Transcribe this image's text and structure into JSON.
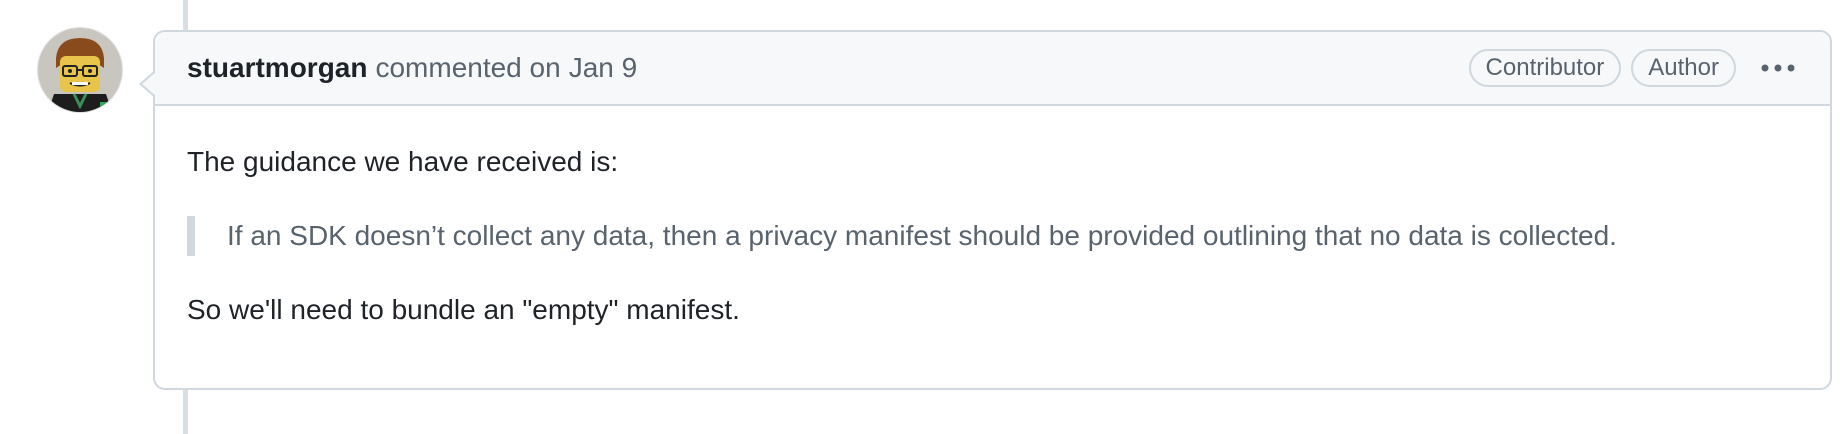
{
  "timeline": {
    "comment": {
      "author": "stuartmorgan",
      "action_text": "commented on",
      "date": "Jan 9",
      "badges": [
        "Contributor",
        "Author"
      ],
      "more_options_icon": "kebab-horizontal-icon",
      "body": {
        "paragraph_1": "The guidance we have received is:",
        "quote": "If an SDK doesn’t collect any data, then a privacy manifest should be provided outlining that no data is collected.",
        "paragraph_2": "So we'll need to bundle an \"empty\" manifest."
      },
      "avatar_icon": "lego-minifigure-avatar"
    }
  },
  "colors": {
    "border": "#d0d7de",
    "header_bg": "#f6f8fa",
    "text_primary": "#1f2328",
    "text_muted": "#59636e",
    "timeline_line": "#d8dee4"
  }
}
